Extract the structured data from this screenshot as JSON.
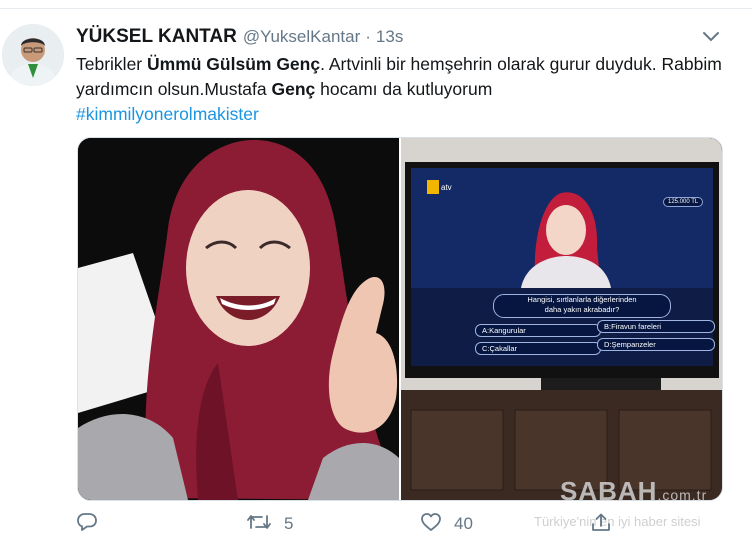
{
  "tweet": {
    "author_name": "YÜKSEL KANTAR",
    "author_handle": "@YukselKantar",
    "separator": "·",
    "time": "13s",
    "text_1": "Tebrikler ",
    "bold_1": "Ümmü Gülsüm Genç",
    "text_2": ". Artvinli bir hemşehrin olarak gurur duyduk. Rabbim yardımcın olsun.Mustafa ",
    "bold_2": "Genç",
    "text_3": " hocamı da kutluyorum",
    "hashtag": "#kimmilyonerolmakister"
  },
  "tv_screen": {
    "channel": "atv",
    "prize": "125.000 TL",
    "question": "Hangisi, sırtlanlarla diğerlerinden daha yakın akrabadır?",
    "question_line1": "Hangisi, sırtlanlarla diğerlerinden",
    "question_line2": "daha yakın akrabadır?",
    "answer_a": "A:Kangurular",
    "answer_b": "B:Firavun fareleri",
    "answer_c": "C:Çakallar",
    "answer_d": "D:Şempanzeler"
  },
  "actions": {
    "reply_count": "",
    "retweet_count": "5",
    "like_count": "40"
  },
  "watermark": {
    "logo": "SABAH",
    "domain": ".com.tr",
    "tagline": "Türkiye'nin en iyi haber sitesi"
  },
  "colors": {
    "link": "#1b95e0",
    "muted": "#657786",
    "text": "#14171a"
  },
  "icons": [
    "chevron-down-icon",
    "reply-icon",
    "retweet-icon",
    "like-icon",
    "share-icon"
  ]
}
